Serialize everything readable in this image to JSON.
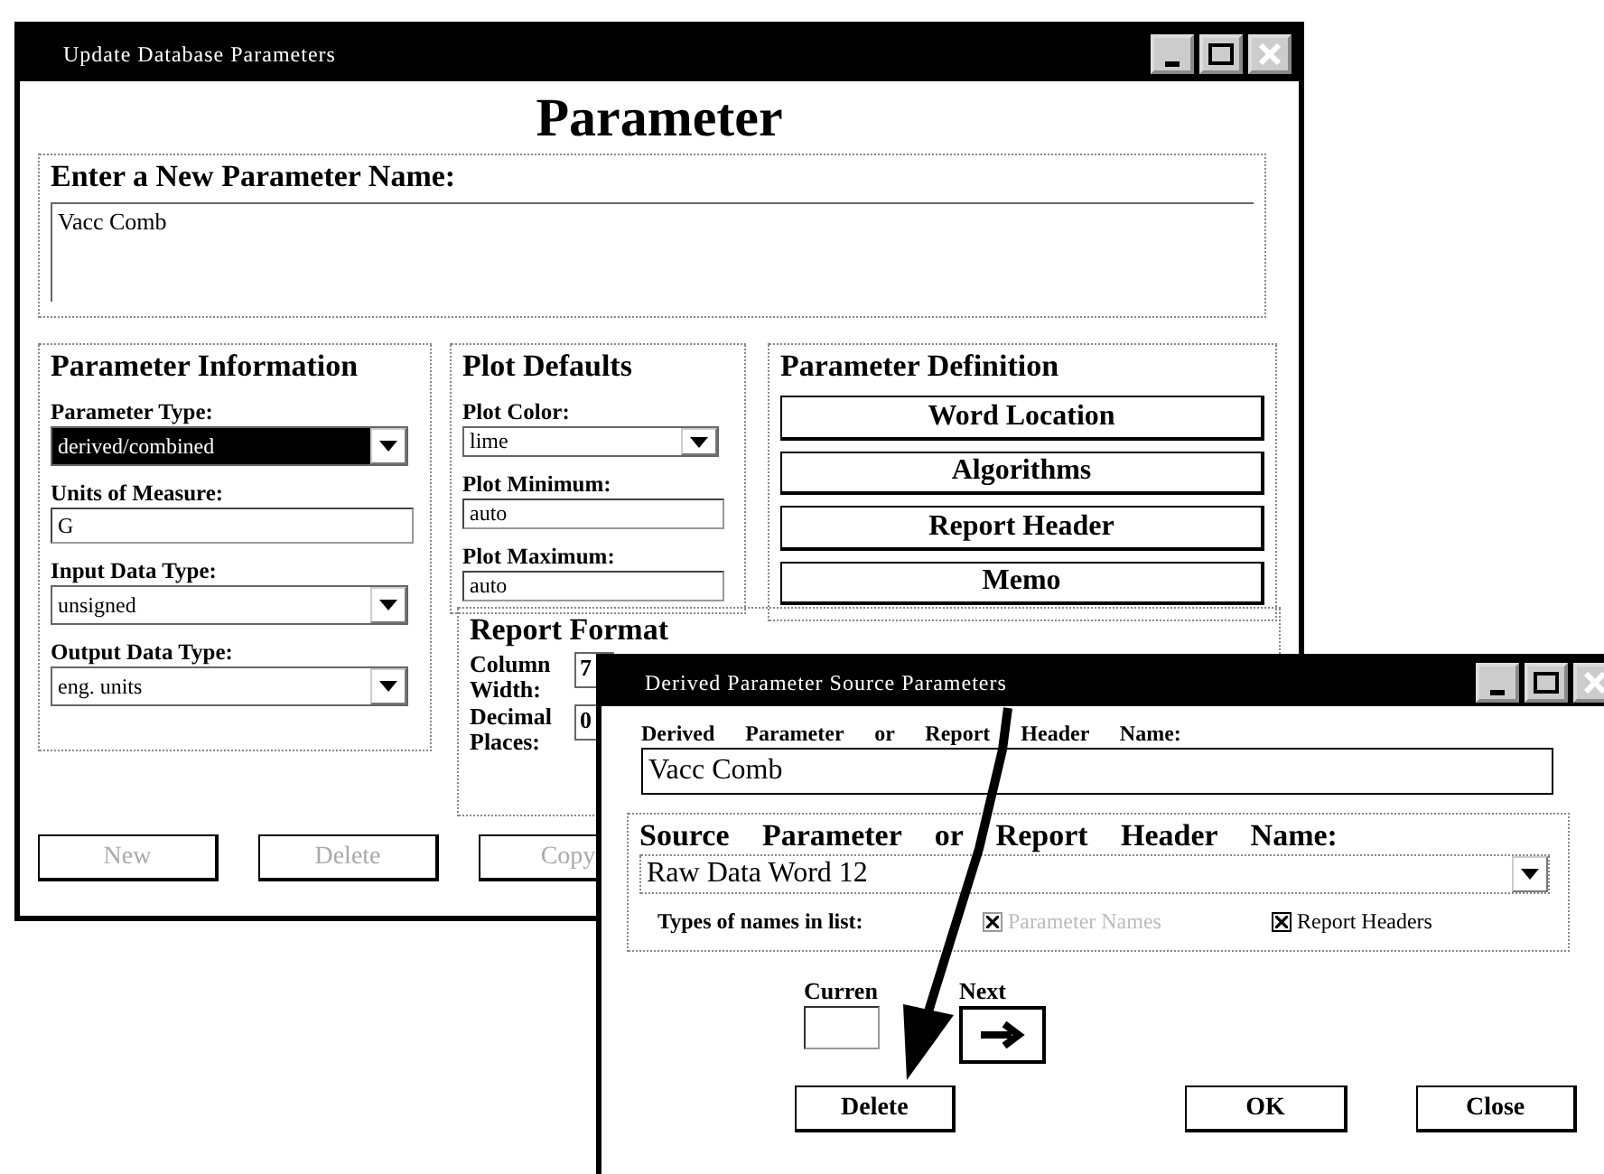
{
  "main_window": {
    "title": "Update Database Parameters",
    "heading": "Parameter",
    "name_group": {
      "label": "Enter a New Parameter Name:",
      "value": "Vacc Comb"
    },
    "parameter_information": {
      "title": "Parameter Information",
      "fields": [
        {
          "label": "Parameter Type:",
          "kind": "dropdown",
          "value": "derived/combined",
          "selected": true
        },
        {
          "label": "Units of Measure:",
          "kind": "text",
          "value": "G"
        },
        {
          "label": "Input Data Type:",
          "kind": "dropdown",
          "value": "unsigned",
          "selected": false
        },
        {
          "label": "Output Data Type:",
          "kind": "dropdown",
          "value": "eng. units",
          "selected": false
        }
      ]
    },
    "plot_defaults": {
      "title": "Plot Defaults",
      "fields": [
        {
          "label": "Plot Color:",
          "kind": "dropdown",
          "value": "lime",
          "selected": false
        },
        {
          "label": "Plot Minimum:",
          "kind": "text",
          "value": "auto"
        },
        {
          "label": "Plot Maximum:",
          "kind": "text",
          "value": "auto"
        }
      ]
    },
    "parameter_definition": {
      "title": "Parameter Definition",
      "buttons": [
        {
          "label": "Word Location"
        },
        {
          "label": "Algorithms"
        },
        {
          "label": "Report Header"
        },
        {
          "label": "Memo"
        }
      ]
    },
    "report_format": {
      "title": "Report Format",
      "fields": [
        {
          "label": "Column Width:",
          "value": "7"
        },
        {
          "label": "Decimal Places:",
          "value": "0"
        }
      ]
    },
    "buttons": [
      {
        "label": "New",
        "disabled": true
      },
      {
        "label": "Delete",
        "disabled": true
      },
      {
        "label": "Copy",
        "disabled": true
      }
    ]
  },
  "source_window": {
    "title": "Derived Parameter Source Parameters",
    "name_label": "Derived Parameter or Report Header Name:",
    "name_value": "Vacc Comb",
    "source_group": {
      "label": "Source Parameter or Report Header Name:",
      "value": "Raw Data Word 12",
      "types_label": "Types of names in list:",
      "types": [
        {
          "label": "Parameter Names",
          "checked": true,
          "disabled": true
        },
        {
          "label": "Report Headers",
          "checked": true,
          "disabled": false
        }
      ]
    },
    "current_label": "Curren",
    "next_label": "Next",
    "buttons": [
      {
        "label": "Delete"
      },
      {
        "label": "OK"
      },
      {
        "label": "Close"
      }
    ]
  }
}
